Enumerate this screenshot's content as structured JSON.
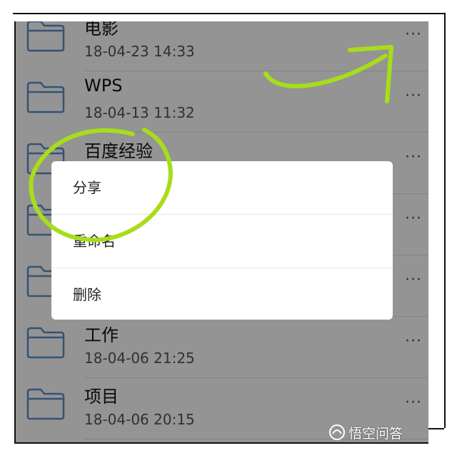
{
  "files": [
    {
      "name": "电影",
      "date": "18-04-23 14:33"
    },
    {
      "name": "WPS",
      "date": "18-04-13 11:32"
    },
    {
      "name": "百度经验",
      "date": ""
    },
    {
      "name": "",
      "date": ""
    },
    {
      "name": "",
      "date": ""
    },
    {
      "name": "工作",
      "date": "18-04-06 21:25"
    },
    {
      "name": "项目",
      "date": "18-04-06 20:15"
    }
  ],
  "more_glyph": "···",
  "context_menu": {
    "items": [
      {
        "label": "分享"
      },
      {
        "label": "重命名"
      },
      {
        "label": "删除"
      }
    ]
  },
  "watermark": {
    "text": "悟空问答"
  },
  "colors": {
    "annotation": "#a8dd1a",
    "folder_stroke": "#5b8fc8",
    "overlay": "rgba(0,0,0,0.42)"
  },
  "icons": [
    "folder-icon",
    "more-icon",
    "watermark-logo-icon"
  ]
}
